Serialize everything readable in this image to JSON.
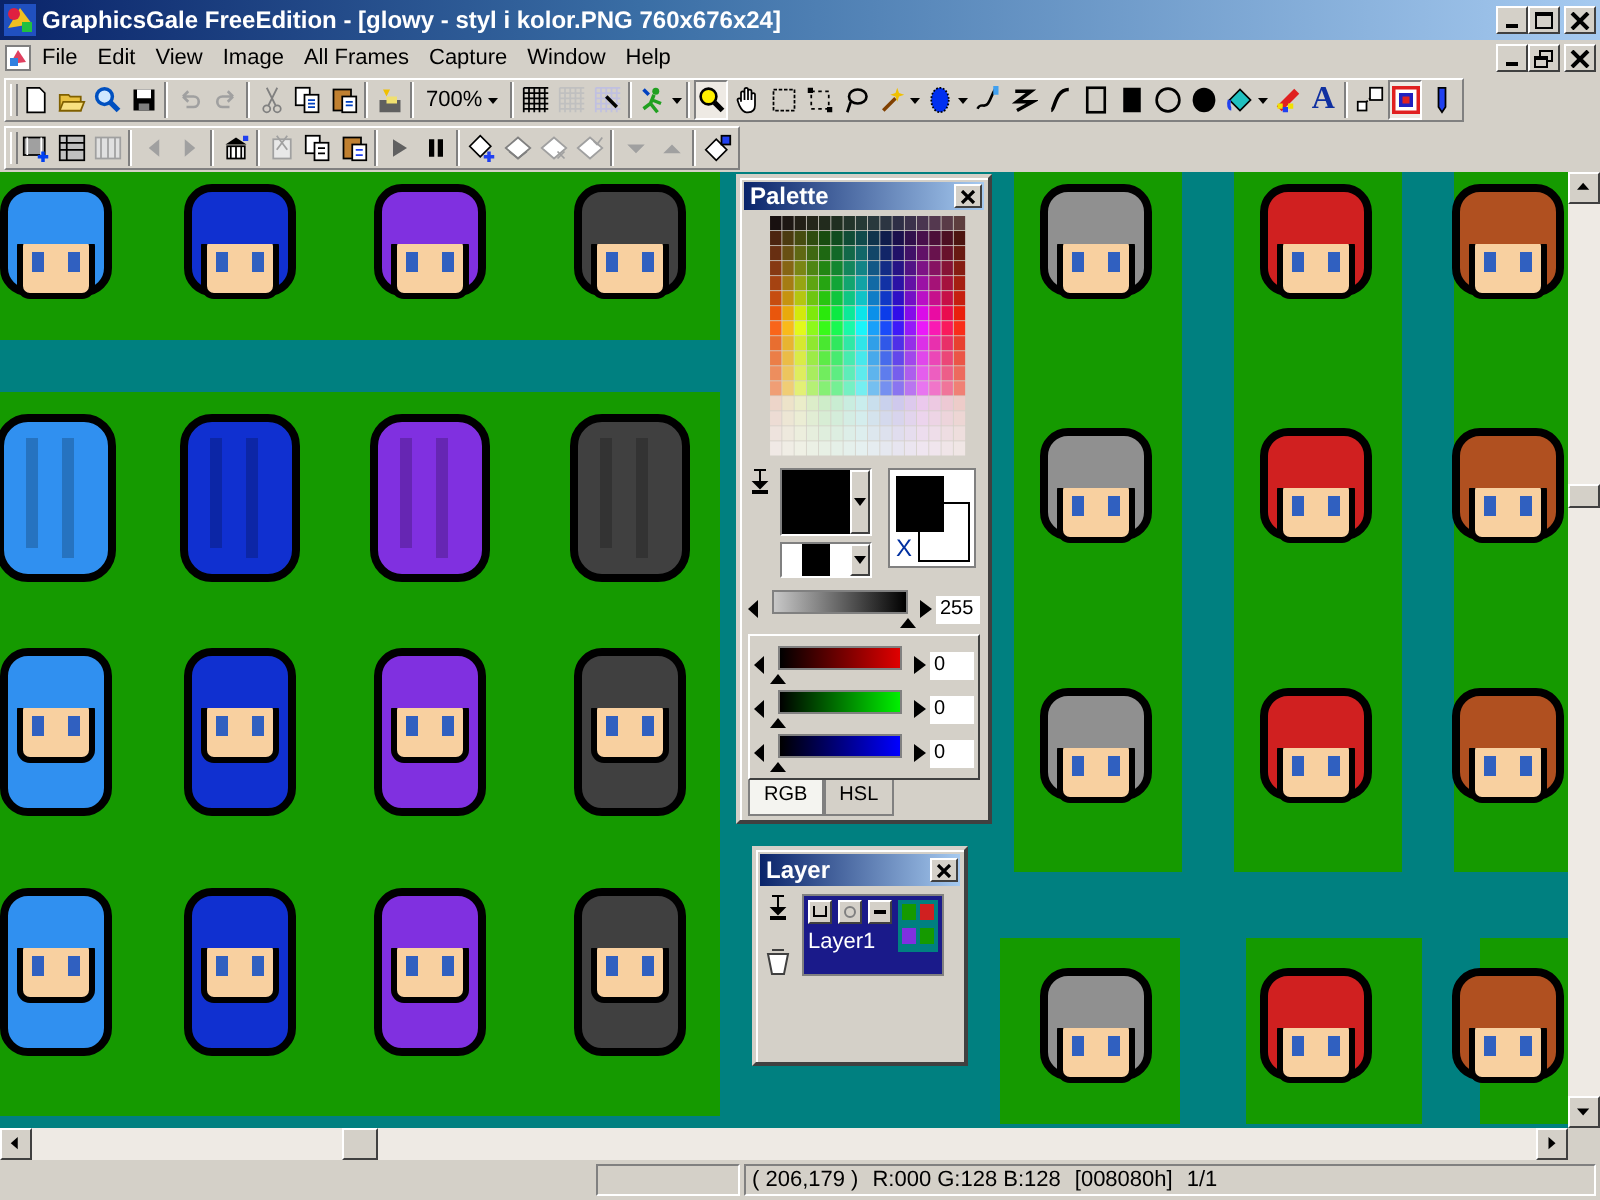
{
  "window": {
    "title": "GraphicsGale FreeEdition - [glowy - styl i kolor.PNG 760x676x24]"
  },
  "menu": [
    "File",
    "Edit",
    "View",
    "Image",
    "All Frames",
    "Capture",
    "Window",
    "Help"
  ],
  "toolbar": {
    "zoom": "700%",
    "text_tool": "A"
  },
  "palette": {
    "title": "Palette",
    "swap_label": "X",
    "brightness": {
      "level": 1,
      "reading": "255"
    },
    "channels": [
      {
        "kind": "red",
        "level": 0,
        "reading": "0"
      },
      {
        "kind": "green",
        "level": 0,
        "reading": "0"
      },
      {
        "kind": "blue",
        "level": 0,
        "reading": "0"
      }
    ],
    "tabs": [
      {
        "label": "RGB",
        "selected": true
      },
      {
        "label": "HSL",
        "selected": false
      }
    ]
  },
  "layer_panel": {
    "title": "Layer",
    "layers": [
      {
        "name": "Layer1",
        "selected": true
      }
    ]
  },
  "status_bar": {
    "position": "( 206,179 )",
    "rgb_values": "R:000 G:128 B:128",
    "hex": "[008080h]",
    "frame": "1/1"
  }
}
